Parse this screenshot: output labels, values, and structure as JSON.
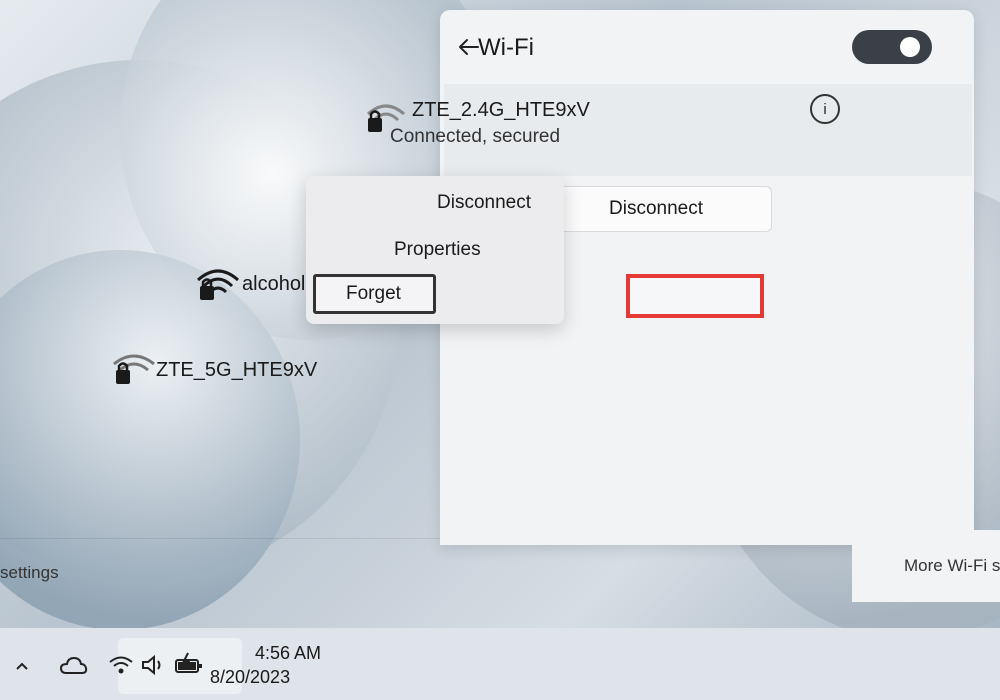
{
  "wifi_panel": {
    "title": "Wi-Fi",
    "toggle_state": "on",
    "connected_network": {
      "name": "ZTE_2.4G_HTE9xV",
      "status": "Connected, secured"
    },
    "disconnect_label": "Disconnect",
    "networks": [
      {
        "name": "alcohol",
        "secured": true
      },
      {
        "name": "ZTE_5G_HTE9xV",
        "secured": true
      }
    ],
    "more_settings_label": "More Wi-Fi settings",
    "settings_fragment": "settings"
  },
  "context_menu": {
    "items": [
      {
        "label": "Disconnect"
      },
      {
        "label": "Properties"
      },
      {
        "label": "Forget"
      }
    ]
  },
  "taskbar": {
    "time": "4:56 AM",
    "date": "8/20/2023"
  },
  "colors": {
    "highlight": "#e53935",
    "toggle_on": "#3b3f46"
  }
}
